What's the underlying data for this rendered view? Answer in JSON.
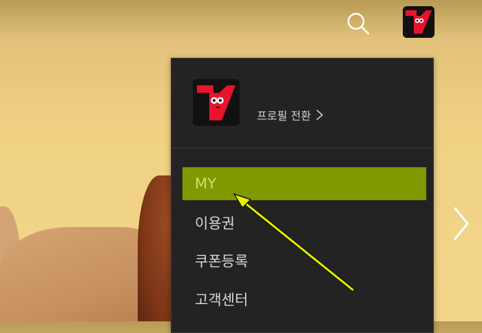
{
  "topbar": {
    "search_icon": "search-icon",
    "profile_icon": "profile-avatar-icon",
    "next_icon": "chevron-right-icon"
  },
  "menu": {
    "switch_profile_label": "프로필 전환",
    "items": [
      {
        "label": "MY",
        "active": true
      },
      {
        "label": "이용권",
        "active": false
      },
      {
        "label": "쿠폰등록",
        "active": false
      },
      {
        "label": "고객센터",
        "active": false
      }
    ]
  },
  "colors": {
    "menu_bg": "#232323",
    "active_bg": "#819801",
    "active_text": "#cfe16a",
    "brand_red": "#e8142d",
    "annotation_arrow": "#e6f000"
  }
}
